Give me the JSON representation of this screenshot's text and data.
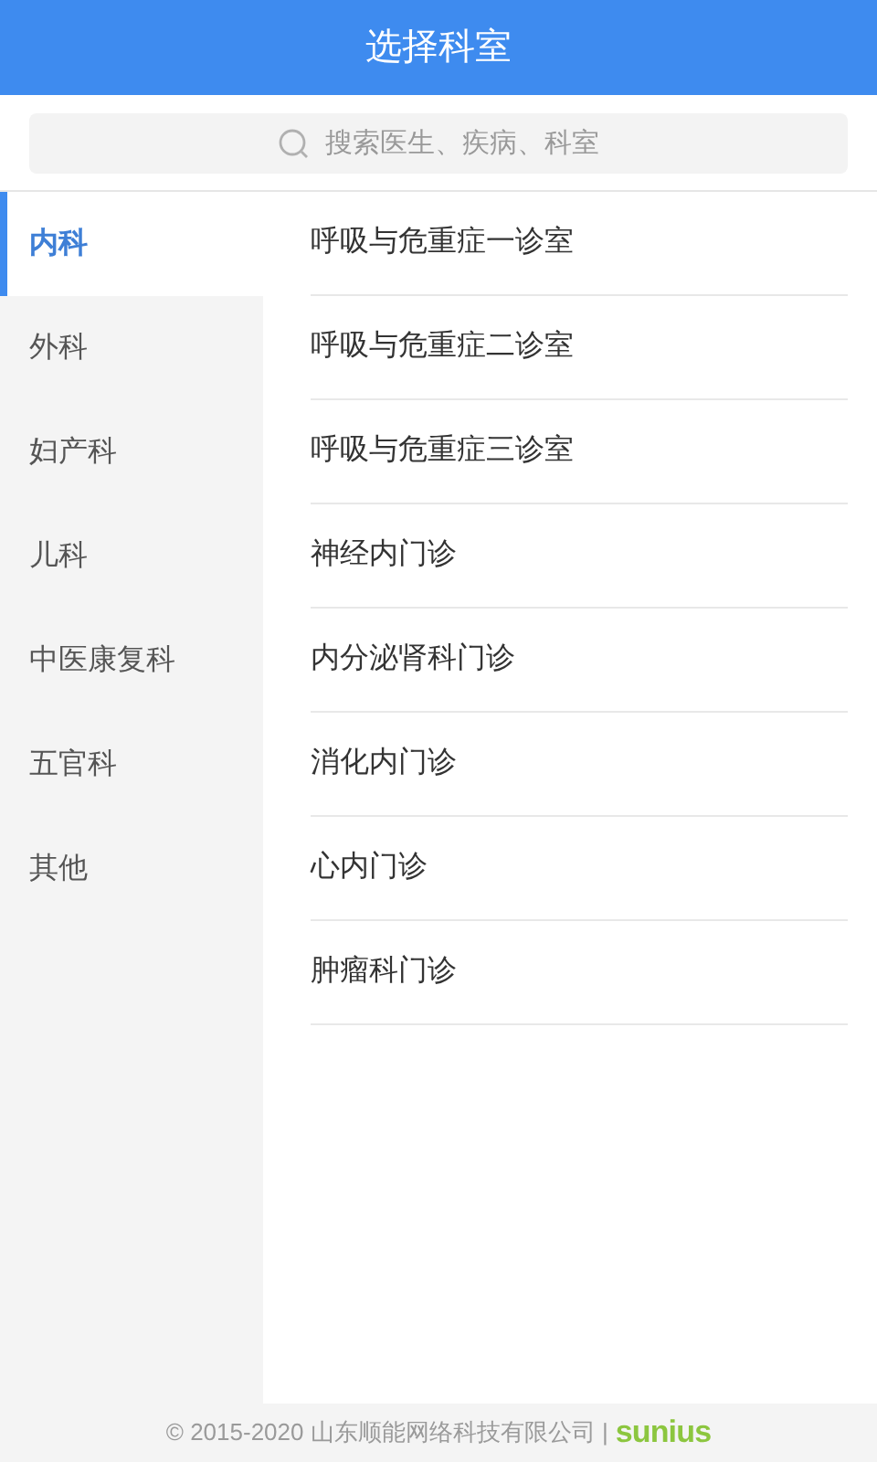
{
  "header": {
    "title": "选择科室"
  },
  "search": {
    "placeholder": "搜索医生、疾病、科室"
  },
  "categories": [
    {
      "label": "内科",
      "selected": true
    },
    {
      "label": "外科",
      "selected": false
    },
    {
      "label": "妇产科",
      "selected": false
    },
    {
      "label": "儿科",
      "selected": false
    },
    {
      "label": "中医康复科",
      "selected": false
    },
    {
      "label": "五官科",
      "selected": false
    },
    {
      "label": "其他",
      "selected": false
    }
  ],
  "departments": [
    "呼吸与危重症一诊室",
    "呼吸与危重症二诊室",
    "呼吸与危重症三诊室",
    "神经内门诊",
    "内分泌肾科门诊",
    "消化内门诊",
    "心内门诊",
    "肿瘤科门诊"
  ],
  "footer": {
    "copyright": "© 2015-2020 山东顺能网络科技有限公司 |",
    "logo": "sunius"
  }
}
